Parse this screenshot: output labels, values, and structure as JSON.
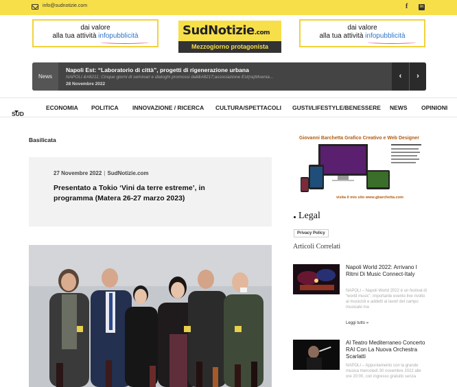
{
  "topbar": {
    "email": "info@sudnotizie.com",
    "facebook_glyph": "f",
    "linkedin_glyph": "in"
  },
  "ads": {
    "left": {
      "line1": "dai valore",
      "line2_prefix": "alla tua attività ",
      "line2_highlight": "infopubblicità"
    },
    "right": {
      "line1": "dai valore",
      "line2_prefix": "alla tua attività ",
      "line2_highlight": "infopubblicità"
    }
  },
  "logo": {
    "brand": "SudNotizie",
    "domain": ".com",
    "tagline": "Mezzogiorno protagonista"
  },
  "ticker": {
    "label": "News",
    "title": "Napoli Est: “Laboratorio di città”, progetti di rigenerazione urbana",
    "excerpt": "NAPOLI &#8211; Cinque giorni di seminari e dialoghi promossi dall&#8217;associazione Est(ra)Moenia...",
    "date": "28 Novembre 2022",
    "prev": "‹",
    "next": "›"
  },
  "nav": {
    "items": [
      "SUD",
      "ECONOMIA",
      "POLITICA",
      "INNOVAZIONE / RICERCA",
      "CULTURA/SPETTACOLI",
      "GUSTI/LIFESTYLE/BENESSERE",
      "NEWS",
      "OPINIONI"
    ]
  },
  "article": {
    "category": "Basilicata",
    "date": "27 Novembre 2022",
    "separator": "|",
    "source": "SudNotizie.com",
    "title": "Presentato a Tokio ‘Vini da terre estreme’, in programma (Matera 26-27 marzo 2023)"
  },
  "sidebar": {
    "banner_title": "Giovanni Barchetta Grafico Creativo e Web Designer",
    "banner_link": "visita il mio sito  www.gbarchetta.com",
    "legal_title": "Legal",
    "privacy_label": "Privacy Policy",
    "related_title": "Articoli Correlati",
    "related": [
      {
        "title": "Napoli World 2022: Arrivano I Ritmi Di Music Connect-Italy",
        "excerpt": "NAPOLI – Napoli World 2022 è un festival di “world music”, importante evento live rivolto ai musicisti e addetti ai lavori del campo musicale ma",
        "more": "Leggi tutto »"
      },
      {
        "title": "Al Teatro Mediterraneo Concerto RAI Con La Nuova Orchestra Scarlatti",
        "excerpt": "NAPOLI – Appuntamento con la grande musica mercoledì 30 novembre 2022 alle ore 20:00, con ingresso gratuito senza"
      }
    ]
  }
}
